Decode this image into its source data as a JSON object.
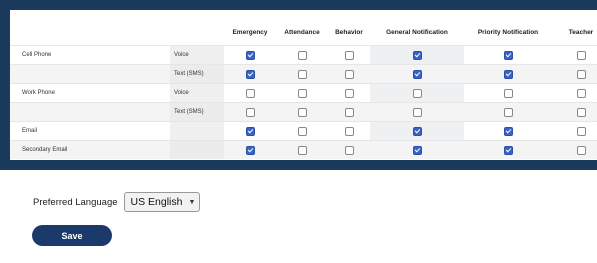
{
  "table": {
    "columns": [
      "Emergency",
      "Attendance",
      "Behavior",
      "General Notification",
      "Priority Notification",
      "Teacher"
    ],
    "rows": [
      {
        "device": "Cell Phone",
        "mode": "Voice",
        "checks": [
          true,
          false,
          false,
          true,
          true,
          false
        ]
      },
      {
        "device": "",
        "mode": "Text (SMS)",
        "checks": [
          true,
          false,
          false,
          true,
          true,
          false
        ]
      },
      {
        "device": "Work Phone",
        "mode": "Voice",
        "checks": [
          false,
          false,
          false,
          false,
          false,
          false
        ]
      },
      {
        "device": "",
        "mode": "Text (SMS)",
        "checks": [
          false,
          false,
          false,
          false,
          false,
          false
        ]
      },
      {
        "device": "Email",
        "mode": "",
        "checks": [
          true,
          false,
          false,
          true,
          true,
          false
        ]
      },
      {
        "device": "Secondary Email",
        "mode": "",
        "checks": [
          true,
          false,
          false,
          true,
          true,
          false
        ]
      }
    ]
  },
  "language": {
    "label": "Preferred Language",
    "selected": "US English"
  },
  "save_label": "Save",
  "colors": {
    "frame": "#1b3a5c",
    "button": "#1b3a6b",
    "checkbox_on": "#3a63c7"
  }
}
